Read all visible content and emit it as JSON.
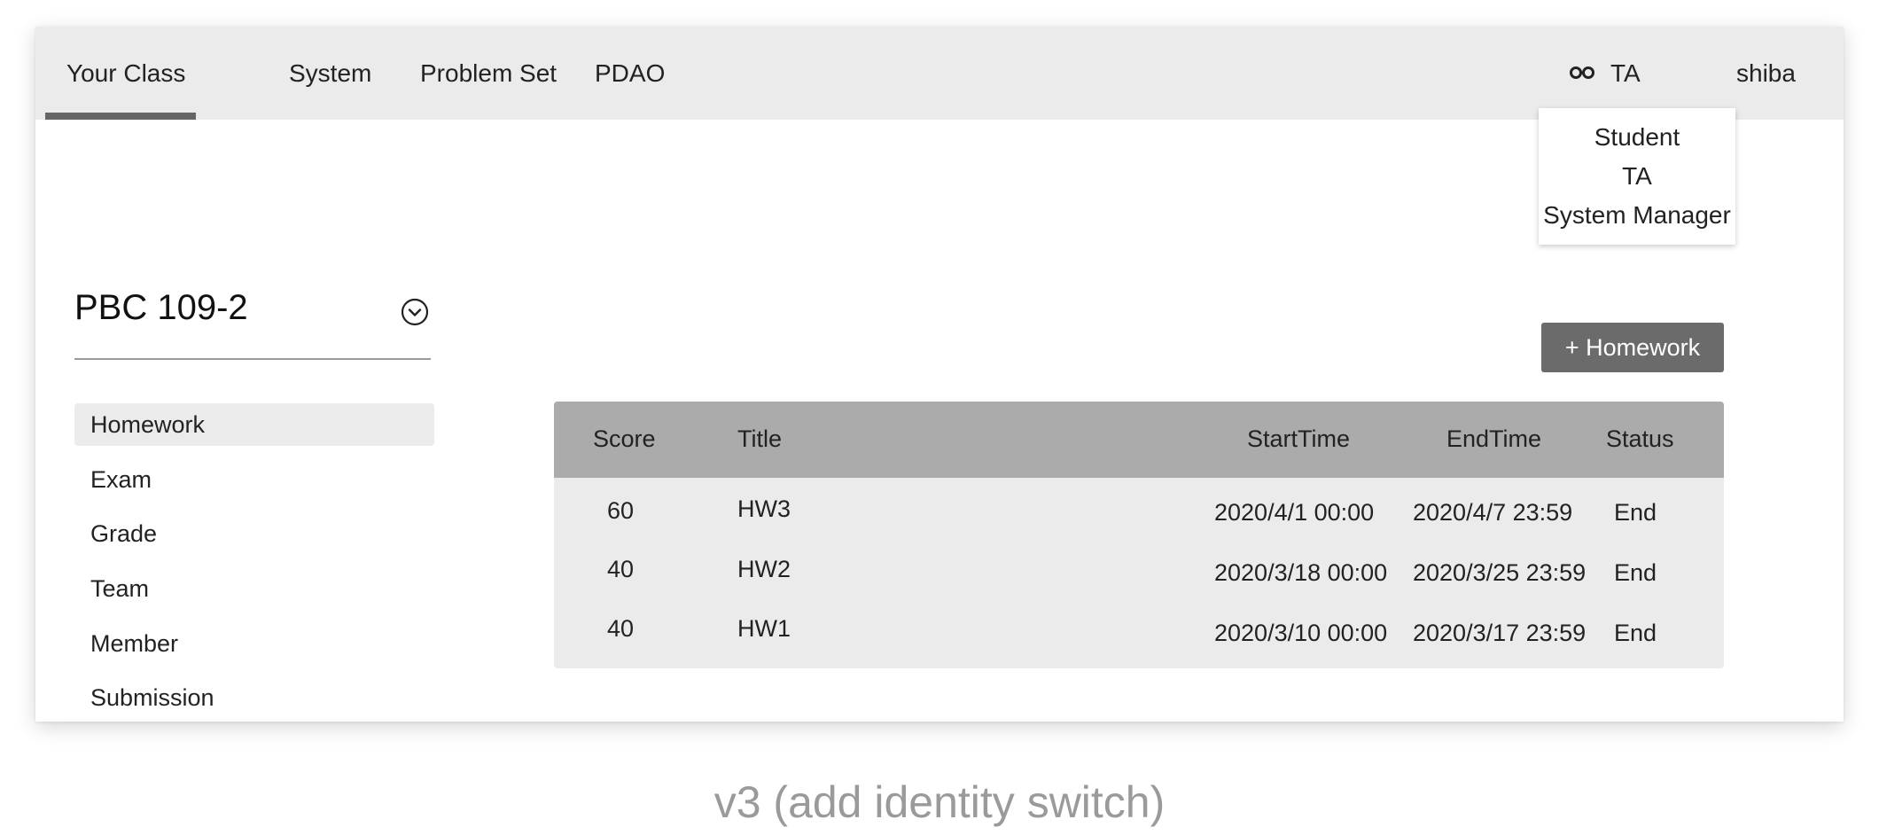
{
  "nav": {
    "items": [
      "Your Class",
      "System",
      "Problem Set",
      "PDAO"
    ],
    "identity": {
      "icon": "glasses-icon",
      "current": "TA"
    },
    "user": "shiba",
    "identity_menu": [
      "Student",
      "TA",
      "System Manager"
    ]
  },
  "sidebar": {
    "class_name": "PBC 109-2",
    "class_toggle_icon": "chevron-down-circle-icon",
    "items": [
      "Homework",
      "Exam",
      "Grade",
      "Team",
      "Member",
      "Submission"
    ],
    "active": "Homework"
  },
  "main": {
    "add_button_label": "+ Homework",
    "table": {
      "headers": [
        "Score",
        "Title",
        "StartTime",
        "EndTime",
        "Status"
      ],
      "rows": [
        {
          "score": "60",
          "title": "HW3",
          "start": "2020/4/1 00:00",
          "end": "2020/4/7 23:59",
          "status": "End"
        },
        {
          "score": "40",
          "title": "HW2",
          "start": "2020/3/18 00:00",
          "end": "2020/3/25 23:59",
          "status": "End"
        },
        {
          "score": "40",
          "title": "HW1",
          "start": "2020/3/10 00:00",
          "end": "2020/3/17 23:59",
          "status": "End"
        }
      ]
    }
  },
  "caption": "v3 (add identity switch)",
  "colors": {
    "nav_bg": "#ebebeb",
    "nav_indicator": "#666666",
    "table_header_bg": "#ababab",
    "table_body_bg": "#ebebeb",
    "button_bg": "#6b6b6b",
    "caption_text": "#9a9a9a"
  }
}
